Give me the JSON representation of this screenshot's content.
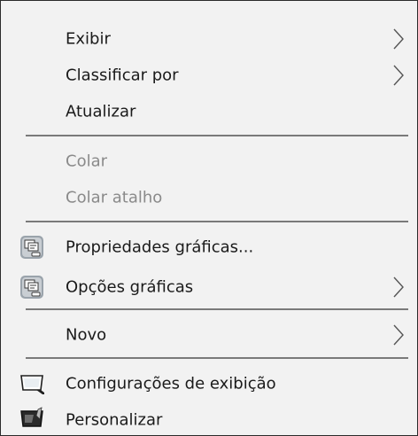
{
  "menu": {
    "items": [
      {
        "label": "Exibir",
        "submenu": true
      },
      {
        "label": "Classificar por",
        "submenu": true
      },
      {
        "label": "Atualizar"
      },
      {
        "label": "Colar",
        "disabled": true
      },
      {
        "label": "Colar atalho",
        "disabled": true
      },
      {
        "label": "Propriedades gráficas...",
        "icon": "graphics-properties-icon"
      },
      {
        "label": "Opções gráficas",
        "icon": "graphics-options-icon",
        "submenu": true
      },
      {
        "label": "Novo",
        "submenu": true
      },
      {
        "label": "Configurações de exibição",
        "icon": "display-settings-icon"
      },
      {
        "label": "Personalizar",
        "icon": "personalize-icon"
      }
    ]
  },
  "colors": {
    "background": "#f2f2f2",
    "text": "#1a1a1a",
    "disabled_text": "#8a8a8a",
    "separator": "#7a7a7a",
    "border": "#2b2b2b"
  }
}
